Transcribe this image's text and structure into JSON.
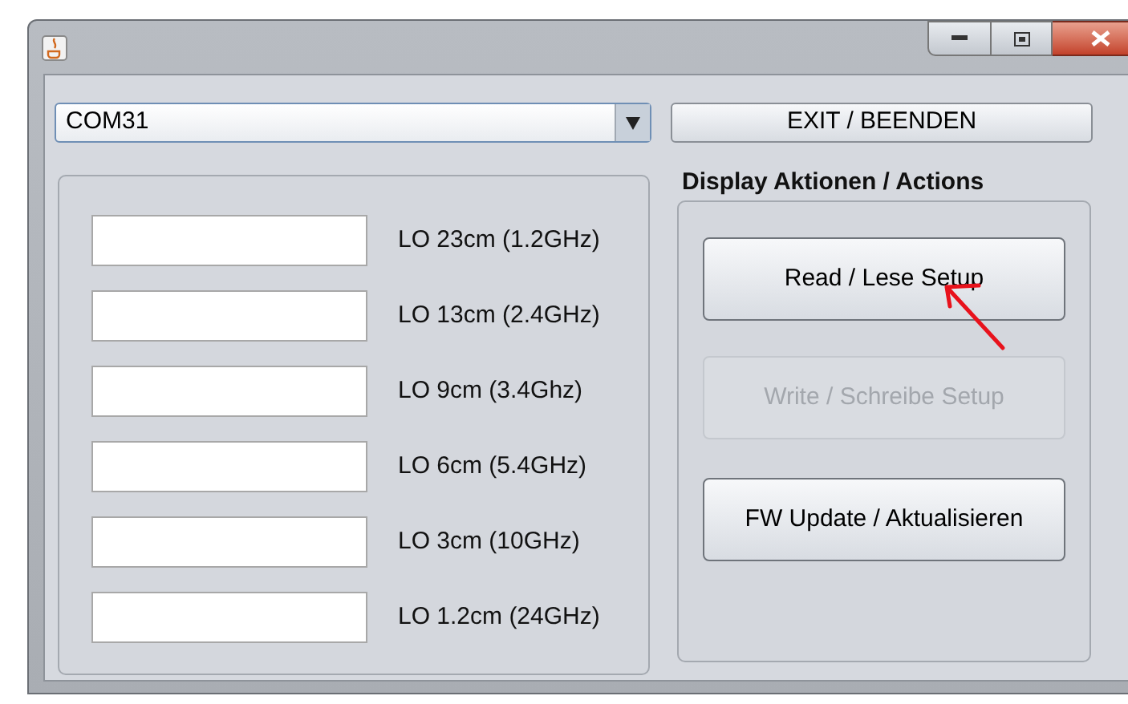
{
  "port_select": {
    "value": "COM31"
  },
  "exit_button": {
    "label": "EXIT / BEENDEN"
  },
  "lo_fields": [
    {
      "label": "LO 23cm (1.2GHz)"
    },
    {
      "label": "LO 13cm (2.4GHz)"
    },
    {
      "label": "LO 9cm (3.4Ghz)"
    },
    {
      "label": "LO 6cm (5.4GHz)"
    },
    {
      "label": "LO 3cm (10GHz)"
    },
    {
      "label": "LO 1.2cm (24GHz)"
    }
  ],
  "actions": {
    "title": "Display Aktionen / Actions",
    "buttons": [
      {
        "label": "Read / Lese Setup",
        "disabled": false
      },
      {
        "label": "Write / Schreibe Setup",
        "disabled": true
      },
      {
        "label": "FW Update / Aktualisieren",
        "disabled": false
      }
    ]
  }
}
